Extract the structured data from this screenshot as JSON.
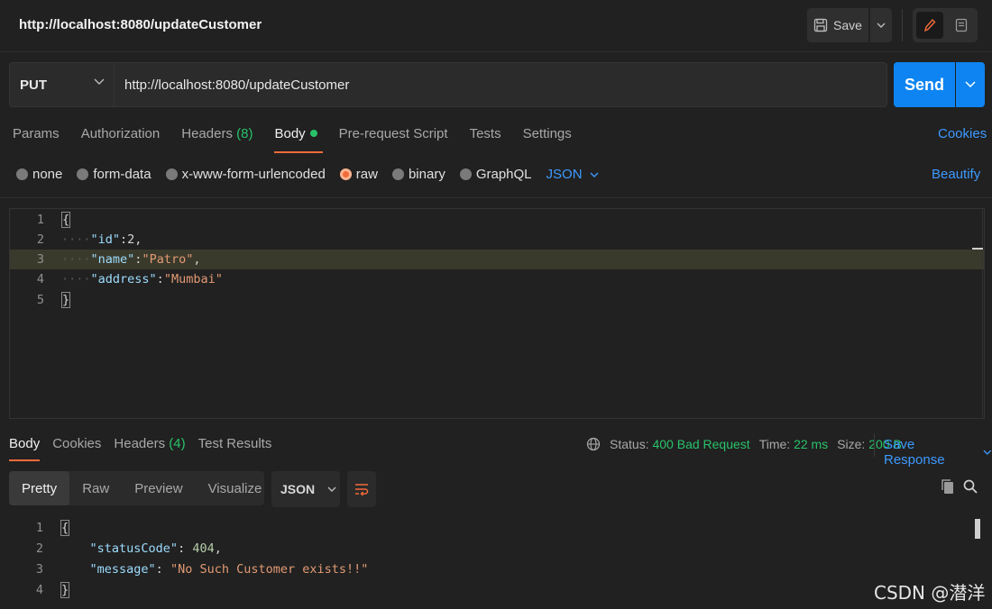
{
  "header": {
    "title": "http://localhost:8080/updateCustomer",
    "save_label": "Save",
    "icons": [
      "save-icon",
      "chevron-down-icon",
      "pencil-icon",
      "document-icon"
    ]
  },
  "request": {
    "method": "PUT",
    "url": "http://localhost:8080/updateCustomer",
    "send_label": "Send",
    "tabs": {
      "params": "Params",
      "authorization": "Authorization",
      "headers": "Headers",
      "headers_count": "(8)",
      "body": "Body",
      "pre_request": "Pre-request Script",
      "tests": "Tests",
      "settings": "Settings"
    },
    "cookies_label": "Cookies",
    "body_types": {
      "none": "none",
      "form_data": "form-data",
      "urlencoded": "x-www-form-urlencoded",
      "raw": "raw",
      "binary": "binary",
      "graphql": "GraphQL"
    },
    "selected_body_type": "raw",
    "language": "JSON",
    "beautify_label": "Beautify",
    "line_numbers": [
      "1",
      "2",
      "3",
      "4",
      "5"
    ],
    "body_lines": {
      "l1": "{",
      "l2_key": "\"id\"",
      "l2_rest": ":2,",
      "l3_key": "\"name\"",
      "l3_colon": ":",
      "l3_val": "\"Patro\"",
      "l3_comma": ",",
      "l4_key": "\"address\"",
      "l4_colon": ":",
      "l4_val": "\"Mumbai\"",
      "l5": "}"
    }
  },
  "response": {
    "tabs": {
      "body": "Body",
      "cookies": "Cookies",
      "headers": "Headers",
      "headers_count": "(4)",
      "test_results": "Test Results"
    },
    "status_label": "Status:",
    "status_value": "400 Bad Request",
    "time_label": "Time:",
    "time_value": "22 ms",
    "size_label": "Size:",
    "size_value": "200 B",
    "save_response_label": "Save Response",
    "views": {
      "pretty": "Pretty",
      "raw": "Raw",
      "preview": "Preview",
      "visualize": "Visualize"
    },
    "format": "JSON",
    "line_numbers": [
      "1",
      "2",
      "3",
      "4"
    ],
    "body_lines": {
      "l1": "{",
      "l2_key": "\"statusCode\"",
      "l2_colon": ": ",
      "l2_val": "404",
      "l2_comma": ",",
      "l3_key": "\"message\"",
      "l3_colon": ": ",
      "l3_val": "\"No Such Customer exists!!\"",
      "l4": "}"
    }
  },
  "watermark": "CSDN @潜洋",
  "colors": {
    "background": "#212121",
    "accent_blue": "#0d84f1",
    "link_blue": "#3d9aff",
    "active_orange": "#f26b3a",
    "status_green": "#29c26a"
  }
}
